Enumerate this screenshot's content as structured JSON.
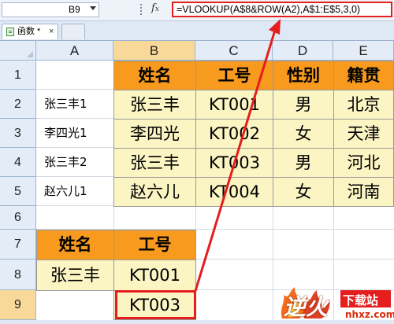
{
  "formula_bar": {
    "name_box": "B9",
    "fx_label": "fx",
    "formula": "=VLOOKUP(A$8&ROW(A2),A$1:E$5,3,0)"
  },
  "sheet_tabs": {
    "active": "函数 *",
    "close": "×"
  },
  "columns": [
    "A",
    "B",
    "C",
    "D",
    "E"
  ],
  "rows": [
    "1",
    "2",
    "3",
    "4",
    "5",
    "6",
    "7",
    "8",
    "9"
  ],
  "table1": {
    "headers": [
      "姓名",
      "工号",
      "性别",
      "籍贯"
    ],
    "keys": [
      "张三丰1",
      "李四光1",
      "张三丰2",
      "赵六儿1"
    ],
    "rows": [
      [
        "张三丰",
        "KT001",
        "男",
        "北京"
      ],
      [
        "李四光",
        "KT002",
        "女",
        "天津"
      ],
      [
        "张三丰",
        "KT003",
        "男",
        "河北"
      ],
      [
        "赵六儿",
        "KT004",
        "女",
        "河南"
      ]
    ]
  },
  "table2": {
    "headers": [
      "姓名",
      "工号"
    ],
    "row8": [
      "张三丰",
      "KT001"
    ],
    "b9": "KT003"
  },
  "watermark": {
    "brand": "逆火",
    "tag": "下载站",
    "domain": "nhxz.com"
  },
  "colors": {
    "header_orange": "#f79a1e",
    "data_yellow": "#fbf5c4",
    "highlight_red": "#e51d1d"
  }
}
